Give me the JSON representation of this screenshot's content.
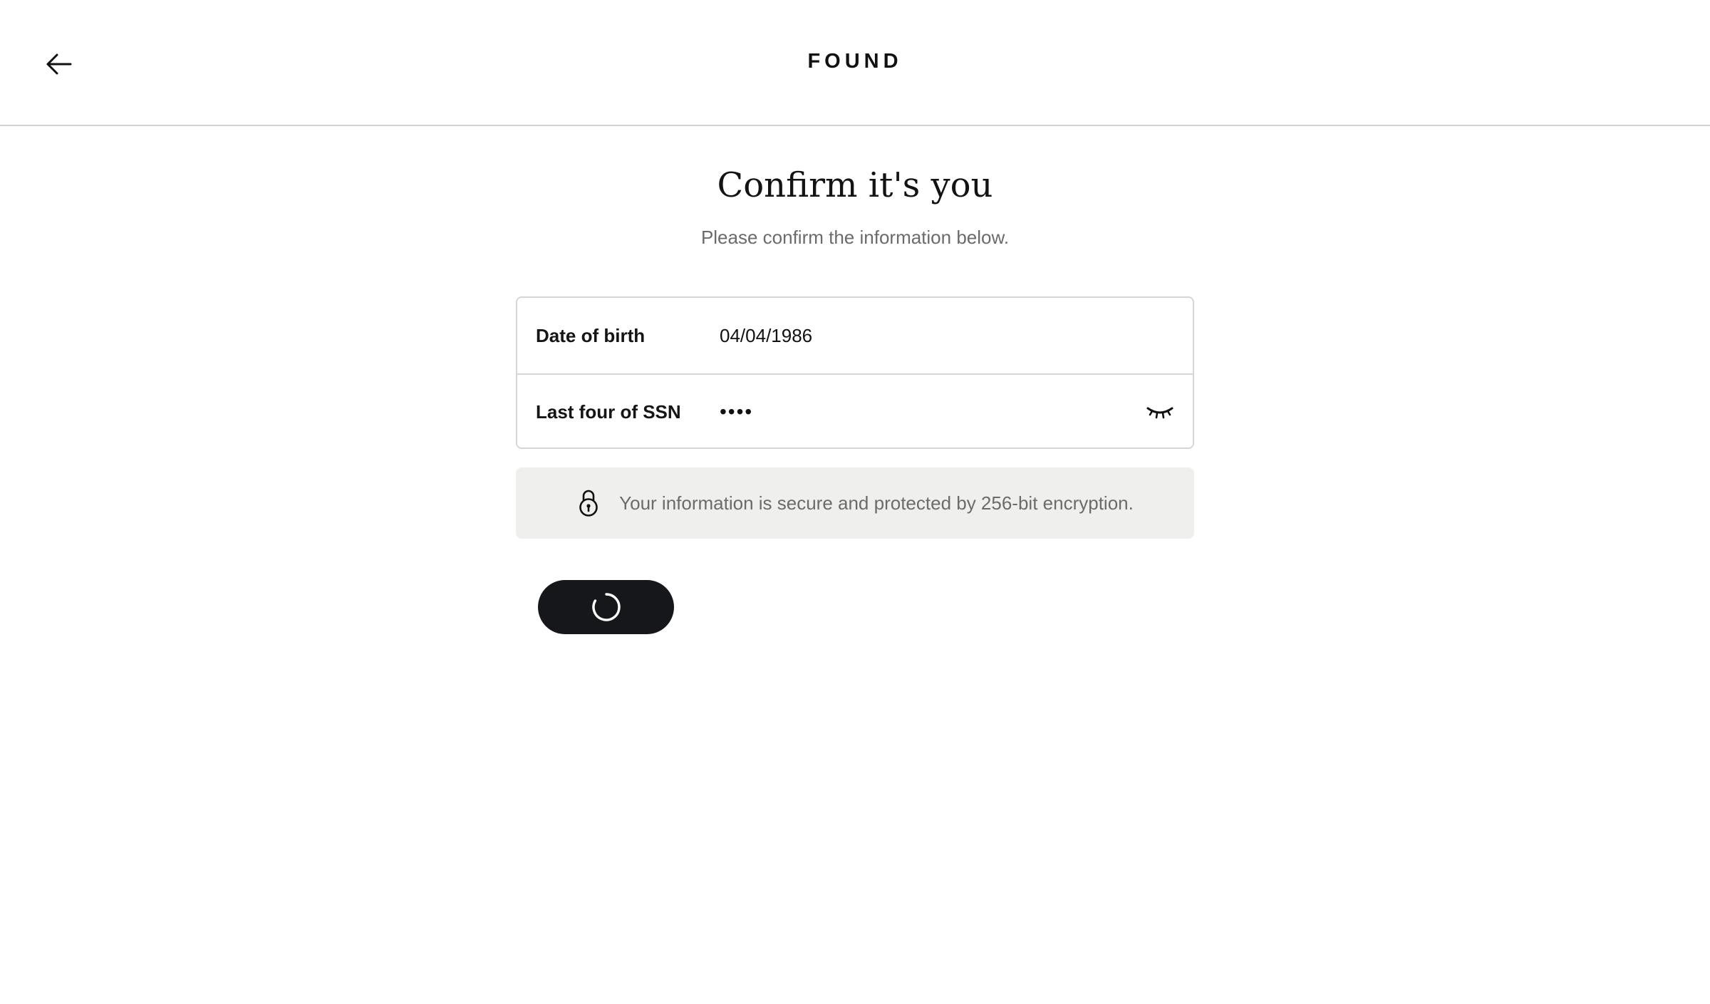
{
  "header": {
    "back_icon": "arrow-left-icon",
    "brand": "FOUND"
  },
  "main": {
    "title": "Confirm it's you",
    "subtitle": "Please confirm the information below."
  },
  "form": {
    "dob": {
      "label": "Date of birth",
      "value": "04/04/1986"
    },
    "ssn": {
      "label": "Last four of SSN",
      "value": "••••",
      "toggle_icon": "eye-closed-icon"
    }
  },
  "security_notice": {
    "icon": "lock-icon",
    "text": "Your information is secure and protected by 256-bit encryption."
  },
  "submit": {
    "state": "loading",
    "icon": "spinner-icon"
  },
  "colors": {
    "primary_button": "#16171a",
    "banner_bg": "#eff0ee",
    "muted_text": "#6b6b6b",
    "border": "#d6d6d6"
  }
}
